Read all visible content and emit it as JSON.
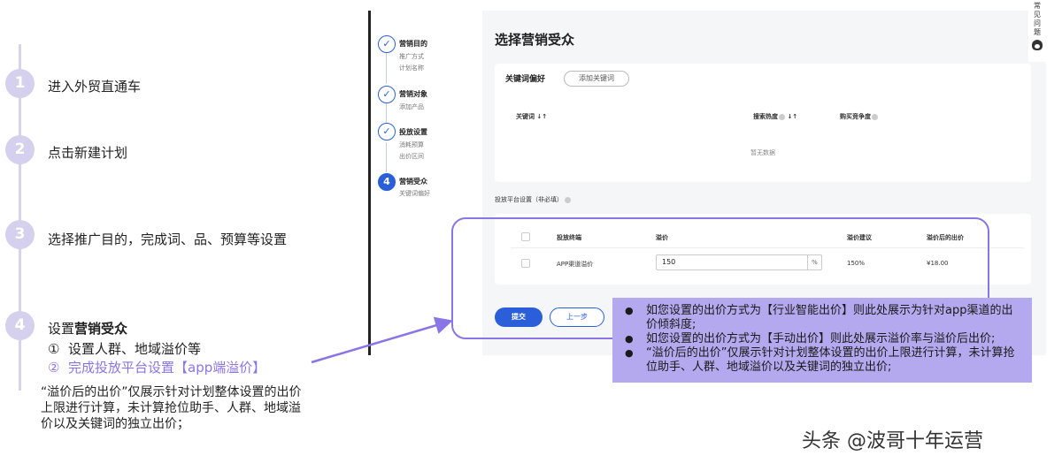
{
  "steps": [
    {
      "num": "1",
      "label": "进入外贸直通车"
    },
    {
      "num": "2",
      "label": "点击新建计划"
    },
    {
      "num": "3",
      "label": "选择推广目的，完成词、品、预算等设置"
    },
    {
      "num": "4",
      "label_prefix": "设置",
      "label_bold": "营销受众"
    }
  ],
  "step4_items": [
    {
      "marker": "①",
      "text": "设置人群、地域溢价等"
    },
    {
      "marker": "②",
      "text": "完成投放平台设置【app端溢价】"
    }
  ],
  "note": "“溢价后的出价”仅展示针对计划整体设置的出价上限进行计算，未计算抢位助手、人群、地域溢价以及关键词的独立出价；",
  "wizard": [
    {
      "icon": "✓",
      "title": "营销目的",
      "subs": [
        "推广方式",
        "计划名称"
      ]
    },
    {
      "icon": "✓",
      "title": "营销对象",
      "subs": [
        "添加产品"
      ]
    },
    {
      "icon": "✓",
      "title": "投放设置",
      "subs": [
        "消耗预算",
        "出价区间"
      ]
    },
    {
      "icon": "4",
      "title": "营销受众",
      "subs": [
        "关键词偏好"
      ]
    }
  ],
  "main": {
    "title": "选择营销受众",
    "kw_label": "关键词偏好",
    "kw_add": "添加关键词",
    "kw_headers": {
      "keyword": "关键词 ↓↑",
      "heat": "搜索热度",
      "heat_sort": "↓↑",
      "competition": "购买竞争度"
    },
    "no_data": "暂无数据",
    "platform_label": "投放平台设置（非必填）",
    "table_headers": {
      "terminal": "投放终端",
      "premium": "溢价",
      "suggest": "溢价建议",
      "after": "溢价后的出价"
    },
    "table_row": {
      "terminal": "APP渠道溢价",
      "premium": "150",
      "unit": "%",
      "suggest": "150%",
      "after": "¥18.00"
    },
    "submit": "提交",
    "prev": "上一步"
  },
  "faq": {
    "lines": [
      "常",
      "见",
      "问",
      "题"
    ]
  },
  "tooltip": [
    "如您设置的出价方式为【行业智能出价】则此处展示为针对app渠道的出价倾斜度;",
    "如您设置的出价方式为【手动出价】则此处展示溢价率与溢价后出价;",
    "“溢价后的出价”仅展示针对计划整体设置的出价上限进行计算，未计算抢位助手、人群、地域溢价以及关键词的独立出价;"
  ],
  "watermark": "头条 @波哥十年运营",
  "colors": {
    "accent_purple": "#8a75e6",
    "step_circle": "#d4d0ee",
    "primary_blue": "#2b5fd9",
    "tooltip_bg": "#b4a8ee"
  }
}
